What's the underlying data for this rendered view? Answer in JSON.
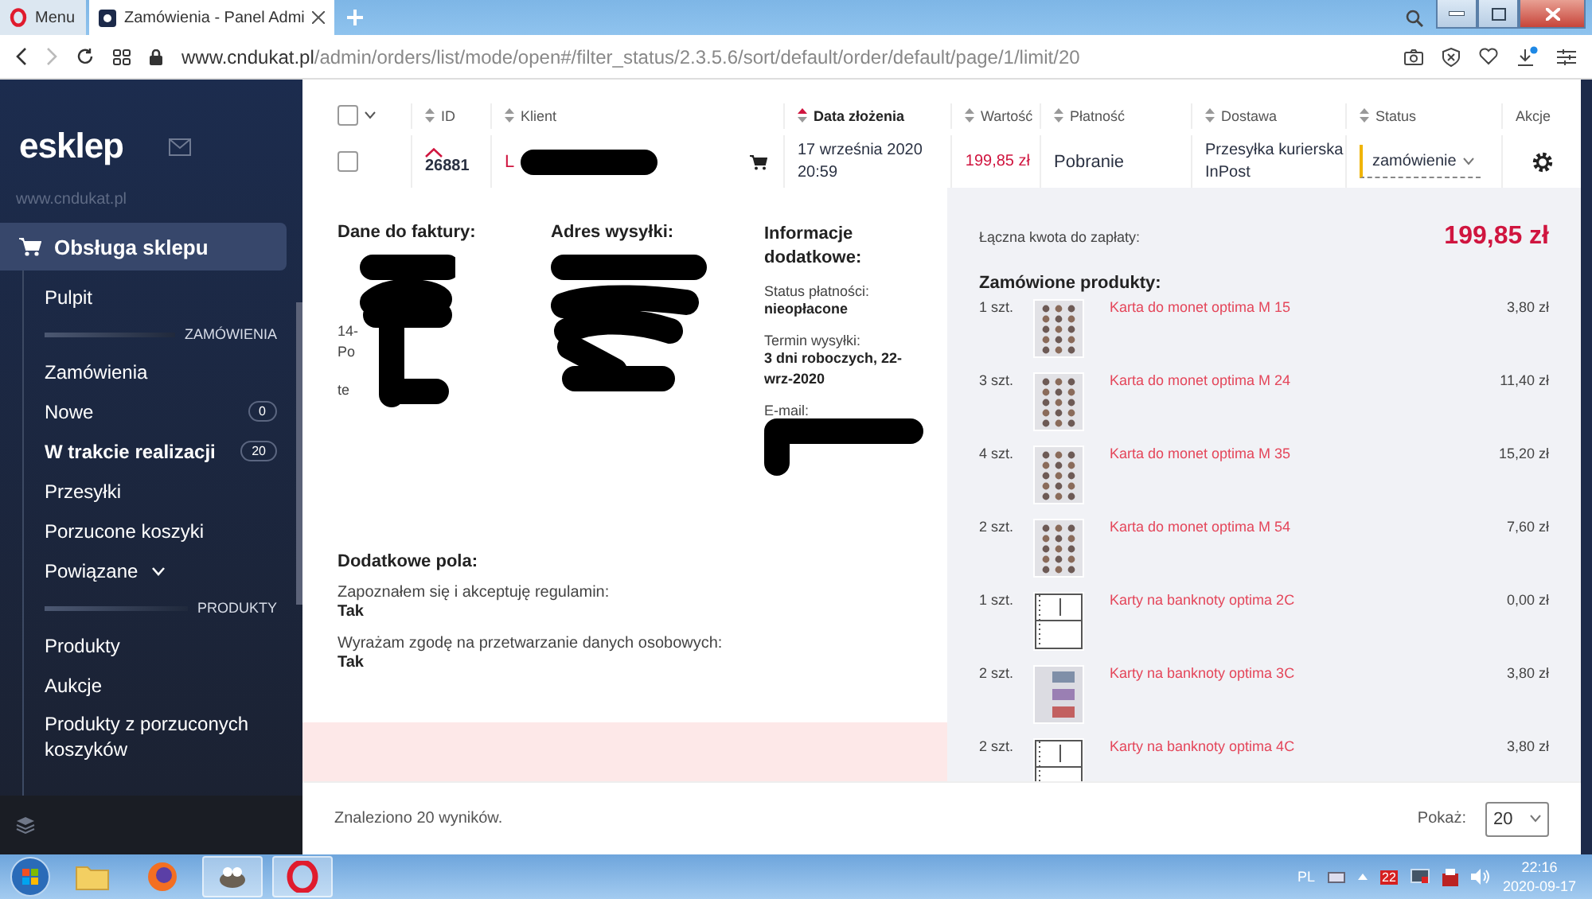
{
  "browser": {
    "tabs": [
      {
        "kind": "menu",
        "title": "Menu",
        "selected": false
      },
      {
        "kind": "page",
        "title": "Zamówienia - Panel Admi",
        "selected": true
      }
    ],
    "url_host": "www.cndukat.pl",
    "url_path": "/admin/orders/list/mode/open#/filter_status/2.3.5.6/sort/default/order/default/page/1/limit/20"
  },
  "sidebar": {
    "logo": "esklep",
    "site": "www.cndukat.pl",
    "section": {
      "label": "Obsługa sklepu",
      "selected": true
    },
    "items": [
      {
        "kind": "link",
        "label": "Pulpit",
        "selected": false
      },
      {
        "kind": "heading",
        "label": "ZAMÓWIENIA"
      },
      {
        "kind": "link",
        "label": "Zamówienia",
        "selected": false
      },
      {
        "kind": "link",
        "label": "Nowe",
        "badge": "0",
        "selected": false
      },
      {
        "kind": "link",
        "label": "W trakcie realizacji",
        "badge": "20",
        "selected": true
      },
      {
        "kind": "link",
        "label": "Przesyłki",
        "selected": false
      },
      {
        "kind": "link",
        "label": "Porzucone koszyki",
        "selected": false
      },
      {
        "kind": "group",
        "label": "Powiązane",
        "expanded": false
      },
      {
        "kind": "heading",
        "label": "PRODUKTY"
      },
      {
        "kind": "link",
        "label": "Produkty",
        "selected": false
      },
      {
        "kind": "link",
        "label": "Aukcje",
        "selected": false
      },
      {
        "kind": "link",
        "label": "Produkty z porzuconych koszyków",
        "selected": false
      }
    ]
  },
  "table": {
    "select_all_checked": false,
    "columns": [
      {
        "label": "ID",
        "kind": "sortable",
        "sorted": false
      },
      {
        "label": "Klient",
        "kind": "sortable",
        "sorted": false
      },
      {
        "label": "Data złożenia",
        "kind": "sortable",
        "sorted": true
      },
      {
        "label": "Wartość",
        "kind": "sortable",
        "sorted": false
      },
      {
        "label": "Płatność",
        "kind": "sortable",
        "sorted": false
      },
      {
        "label": "Dostawa",
        "kind": "sortable",
        "sorted": false
      },
      {
        "label": "Status",
        "kind": "sortable",
        "sorted": false
      },
      {
        "label": "Akcje",
        "kind": "plain",
        "sorted": false
      }
    ],
    "rows": [
      {
        "checked": false,
        "id": "26881",
        "client": "L",
        "date": "17 września 2020 20:59",
        "value": "199,85 zł",
        "payment": "Pobranie",
        "delivery": "Przesyłka kurierska InPost",
        "status": "zamówienie"
      }
    ]
  },
  "details": {
    "billing": {
      "title": "Dane do faktury:",
      "fragments": [
        "14-",
        "Po",
        "te"
      ]
    },
    "shipping": {
      "title": "Adres wysyłki:"
    },
    "info": {
      "title": "Informacje dodatkowe:",
      "fields": [
        {
          "label": "Status płatności:",
          "value": "nieopłacone"
        },
        {
          "label": "Termin wysyłki:",
          "value": "3 dni roboczych, 22-wrz-2020"
        },
        {
          "label": "E-mail:"
        }
      ]
    },
    "extra": {
      "title": "Dodatkowe pola:",
      "fields": [
        {
          "label": "Zapoznałem się i akceptuję regulamin:",
          "value": "Tak"
        },
        {
          "label": "Wyrażam zgodę na przetwarzanie danych osobowych:",
          "value": "Tak"
        }
      ]
    }
  },
  "summary": {
    "total_label": "Łączna kwota do zapłaty:",
    "total": "199,85 zł",
    "products_title": "Zamówione produkty:",
    "products": [
      {
        "qty": "1 szt.",
        "kind": "coins",
        "name": "Karta do monet optima M 15",
        "price": "3,80 zł"
      },
      {
        "qty": "3 szt.",
        "kind": "coins",
        "name": "Karta do monet optima M 24",
        "price": "11,40 zł"
      },
      {
        "qty": "4 szt.",
        "kind": "coins",
        "name": "Karta do monet optima M 35",
        "price": "15,20 zł"
      },
      {
        "qty": "2 szt.",
        "kind": "coins",
        "name": "Karta do monet optima M 54",
        "price": "7,60 zł"
      },
      {
        "qty": "1 szt.",
        "kind": "banknote-sheet",
        "name": "Karty na banknoty optima 2C",
        "price": "0,00 zł"
      },
      {
        "qty": "2 szt.",
        "kind": "banknote-filled",
        "name": "Karty na banknoty optima 3C",
        "price": "3,80 zł"
      },
      {
        "qty": "2 szt.",
        "kind": "banknote-sheet",
        "name": "Karty na banknoty optima 4C",
        "price": "3,80 zł"
      }
    ]
  },
  "footer": {
    "found": "Znaleziono 20 wyników.",
    "show_label": "Pokaż:",
    "show_value": "20"
  },
  "taskbar": {
    "apps": [
      {
        "kind": "folder",
        "open": false
      },
      {
        "kind": "firefox",
        "open": false
      },
      {
        "kind": "gimp",
        "open": true
      },
      {
        "kind": "opera",
        "open": true
      }
    ],
    "lang": "PL",
    "badge": "22",
    "time": "22:16",
    "date": "2020-09-17"
  }
}
